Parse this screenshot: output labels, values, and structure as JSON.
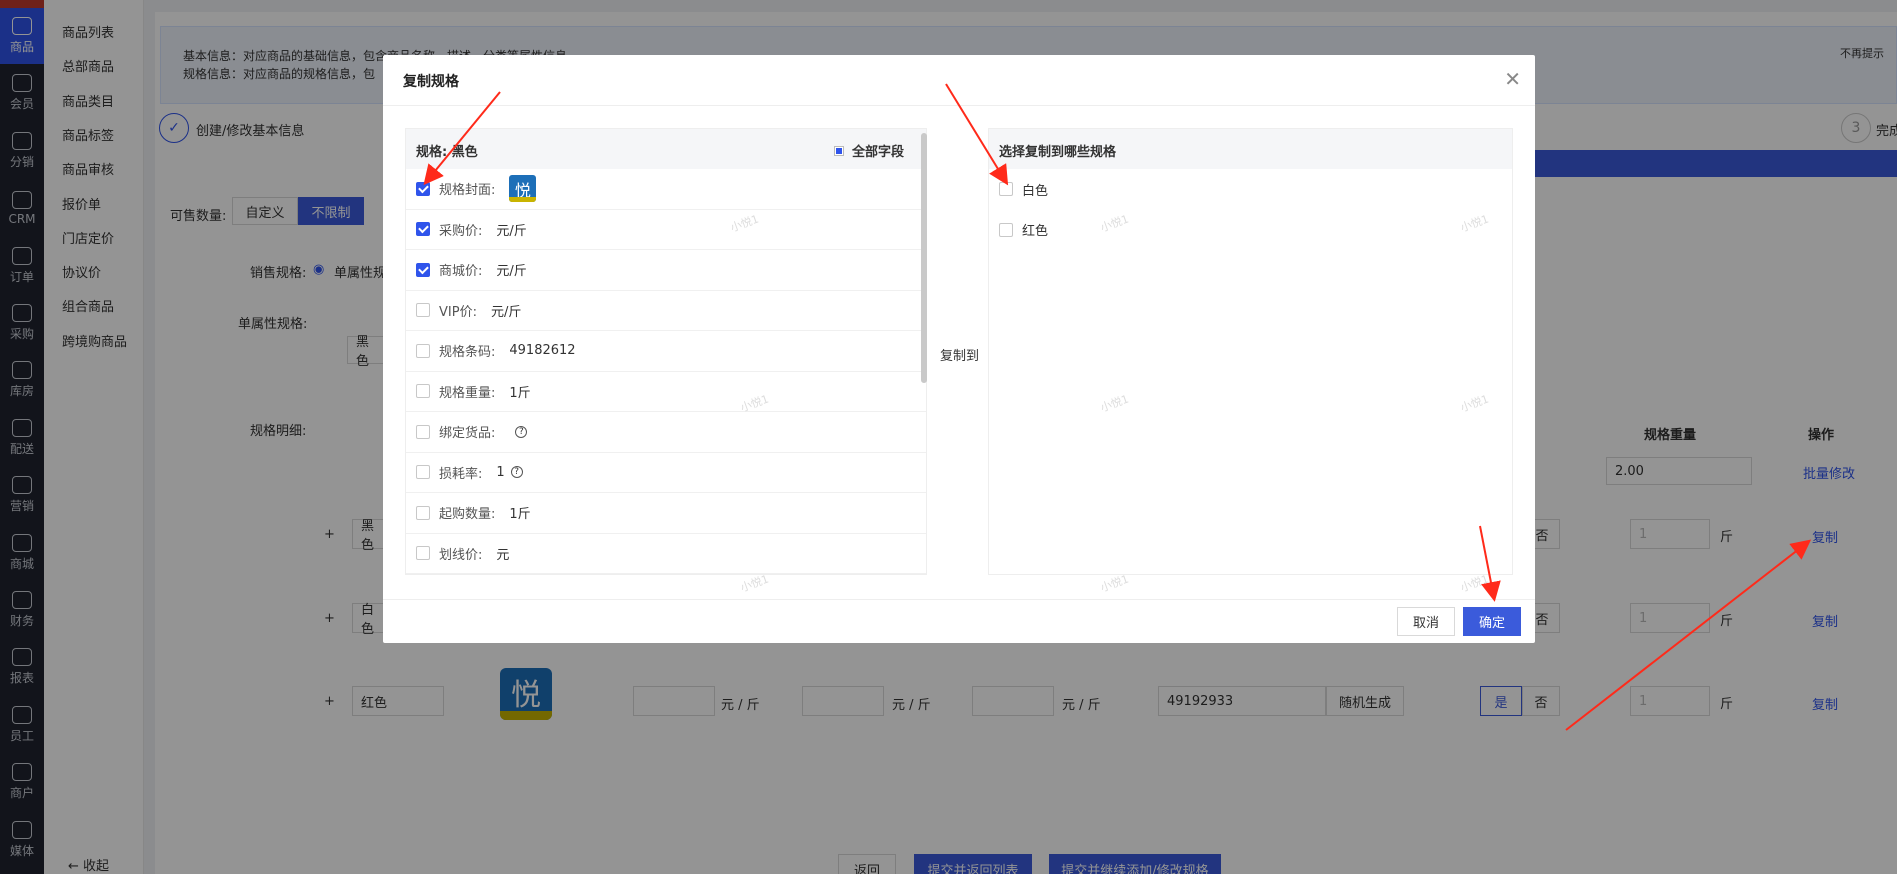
{
  "rail": [
    {
      "label": "商品",
      "icon": "bag-icon",
      "active": true
    },
    {
      "label": "会员",
      "icon": "user-icon"
    },
    {
      "label": "分销",
      "icon": "share-icon"
    },
    {
      "label": "CRM",
      "icon": "crm-icon"
    },
    {
      "label": "订单",
      "icon": "order-icon"
    },
    {
      "label": "采购",
      "icon": "clipboard-icon"
    },
    {
      "label": "库房",
      "icon": "warehouse-icon"
    },
    {
      "label": "配送",
      "icon": "truck-icon"
    },
    {
      "label": "营销",
      "icon": "gift-icon"
    },
    {
      "label": "商城",
      "icon": "home-icon"
    },
    {
      "label": "财务",
      "icon": "yen-icon"
    },
    {
      "label": "报表",
      "icon": "chart-icon"
    },
    {
      "label": "员工",
      "icon": "staff-icon"
    },
    {
      "label": "商户",
      "icon": "shop-icon"
    },
    {
      "label": "媒体",
      "icon": "play-icon"
    }
  ],
  "submenu": [
    "商品列表",
    "总部商品",
    "商品类目",
    "商品标签",
    "商品审核",
    "报价单",
    "门店定价",
    "协议价",
    "组合商品",
    "跨境购商品"
  ],
  "submenu_collapse": "收起",
  "tip": {
    "line1": "基本信息：对应商品的基础信息，包含商品名称、描述、分类等属性信息",
    "line2": "规格信息：对应商品的规格信息，包",
    "dismiss": "不再提示"
  },
  "steps": {
    "step1": "创建/修改基本信息",
    "step3_num": "3",
    "step3": "完成"
  },
  "form": {
    "sellable_label": "可售数量:",
    "custom": "自定义",
    "unlimited": "不限制",
    "sales_spec_label": "销售规格:",
    "single_attr": "单属性规",
    "single_attr_spec": "单属性规格:",
    "spec_chip": "黑色",
    "detail_label": "规格明细:",
    "col_weight": "规格重量",
    "col_op": "操作",
    "batch_weight": "2.00",
    "batch_edit": "批量修改"
  },
  "rows": [
    {
      "name": "黑色",
      "no": "否",
      "qty": "1",
      "unit": "斤",
      "op": "复制"
    },
    {
      "name": "白色",
      "no": "否",
      "qty": "1",
      "unit": "斤",
      "op": "复制"
    },
    {
      "name": "红色",
      "price_unit": "元 / 斤",
      "barcode": "49192933",
      "random": "随机生成",
      "yes": "是",
      "no": "否",
      "qty": "1",
      "unit": "斤",
      "op": "复制"
    }
  ],
  "footer": {
    "back": "返回",
    "submit_list": "提交并返回列表",
    "submit_continue": "提交并继续添加/修改规格"
  },
  "logo_char": "悦",
  "modal": {
    "title": "复制规格",
    "spec_label": "规格: 黑色",
    "all_fields": "全部字段",
    "copy_to": "复制到",
    "target_header": "选择复制到哪些规格",
    "cancel": "取消",
    "ok": "确定",
    "fields": [
      {
        "label": "规格封面:",
        "value": "",
        "checked": true,
        "logo": true
      },
      {
        "label": "采购价:",
        "value": "元/斤",
        "checked": true
      },
      {
        "label": "商城价:",
        "value": "元/斤",
        "checked": true
      },
      {
        "label": "VIP价:",
        "value": "元/斤",
        "checked": false
      },
      {
        "label": "规格条码:",
        "value": "49182612",
        "checked": false
      },
      {
        "label": "规格重量:",
        "value": "1斤",
        "checked": false
      },
      {
        "label": "绑定货品:",
        "value": "",
        "checked": false,
        "help": true
      },
      {
        "label": "损耗率:",
        "value": "1",
        "checked": false,
        "help": true
      },
      {
        "label": "起购数量:",
        "value": "1斤",
        "checked": false
      },
      {
        "label": "划线价:",
        "value": "元",
        "checked": false
      }
    ],
    "targets": [
      {
        "label": "白色",
        "checked": false
      },
      {
        "label": "红色",
        "checked": false
      }
    ]
  },
  "watermark": "小悦1",
  "colors": {
    "accent": "#2f54eb",
    "button": "#3b5bdb",
    "arrow": "#ff2a1a",
    "rail": "#1f2430"
  }
}
